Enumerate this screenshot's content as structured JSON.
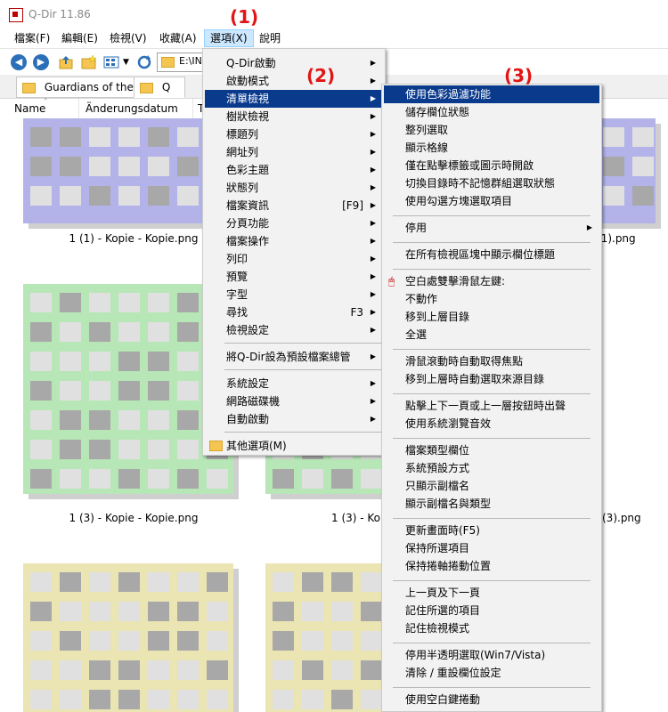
{
  "window": {
    "title": "Q-Dir 11.86"
  },
  "menubar": {
    "items": [
      "檔案(F)",
      "編輯(E)",
      "檢視(V)",
      "收藏(A)",
      "選項(X)",
      "說明"
    ],
    "active_index": 4
  },
  "toolbar": {
    "address": "E:\\INI",
    "icons": [
      "back-icon",
      "forward-icon",
      "up-folder-icon",
      "new-folder-icon",
      "view-mode-icon",
      "dropdown-icon",
      "refresh-icon",
      "folder-icon"
    ]
  },
  "tabs": [
    "Guardians of the ...",
    "Q"
  ],
  "columns": [
    "Name",
    "Änderungsdatum",
    "T"
  ],
  "files": [
    "1 (1) - Kopie - Kopie.png",
    "(1).png",
    "1 (3) - Kopie - Kopie.png",
    "1 (3) - Ko",
    "(3).png"
  ],
  "annotations": [
    "(1)",
    "(2)",
    "(3)"
  ],
  "options_menu": {
    "items": [
      {
        "label": "Q-Dir啟動",
        "submenu": true
      },
      {
        "label": "啟動模式",
        "submenu": true
      },
      {
        "label": "清單檢視",
        "submenu": true,
        "highlighted": true
      },
      {
        "label": "樹狀檢視",
        "submenu": true
      },
      {
        "label": "標題列",
        "submenu": true
      },
      {
        "label": "網址列",
        "submenu": true
      },
      {
        "label": "色彩主題",
        "submenu": true
      },
      {
        "label": "狀態列",
        "submenu": true
      },
      {
        "label": "檔案資訊",
        "shortcut": "[F9]",
        "submenu": true
      },
      {
        "label": "分頁功能",
        "submenu": true
      },
      {
        "label": "檔案操作",
        "submenu": true
      },
      {
        "label": "列印",
        "submenu": true
      },
      {
        "label": "預覽",
        "submenu": true
      },
      {
        "label": "字型",
        "submenu": true
      },
      {
        "label": "尋找",
        "shortcut": "F3",
        "submenu": true
      },
      {
        "label": "檢視設定",
        "submenu": true
      },
      {
        "label": "將Q-Dir設為預設檔案總管",
        "submenu": true
      },
      {
        "label": "系統設定",
        "submenu": true
      },
      {
        "label": "網路磁碟機",
        "submenu": true
      },
      {
        "label": "自動啟動",
        "submenu": true
      },
      {
        "label": "其他選項(M)",
        "submenu": false
      }
    ]
  },
  "list_view_submenu": {
    "items": [
      "使用色彩過濾功能",
      "儲存欄位狀態",
      "整列選取",
      "顯示格線",
      "僅在點擊標籤或圖示時開啟",
      "切換目錄時不記憶群組選取狀態",
      "使用勾選方塊選取項目",
      "停用",
      "在所有檢視區塊中顯示欄位標題",
      "空白處雙擊滑鼠左鍵:",
      "不動作",
      "移到上層目錄",
      "全選",
      "滑鼠滾動時自動取得焦點",
      "移到上層時自動選取來源目錄",
      "點擊上下一頁或上一層按鈕時出聲",
      "使用系統瀏覽音效",
      "檔案類型欄位",
      "系統預設方式",
      "只顯示副檔名",
      "顯示副檔名與類型",
      "更新畫面時(F5)",
      "保持所選項目",
      "保持捲軸捲動位置",
      "上一頁及下一頁",
      "記住所選的項目",
      "記住檢視模式",
      "停用半透明選取(Win7/Vista)",
      "清除 / 重設欄位設定",
      "使用空白鍵捲動"
    ]
  },
  "colors": {
    "highlight": "#0a3a8c",
    "menu_bg": "#f2f2f2",
    "annotation": "#e21414",
    "thumb_purple": "#b3b3ea",
    "thumb_green": "#b7e6b7",
    "thumb_yellow": "#ebe4b3",
    "cell_light": "#e0e0e0",
    "cell_dark": "#a8a8a8"
  }
}
